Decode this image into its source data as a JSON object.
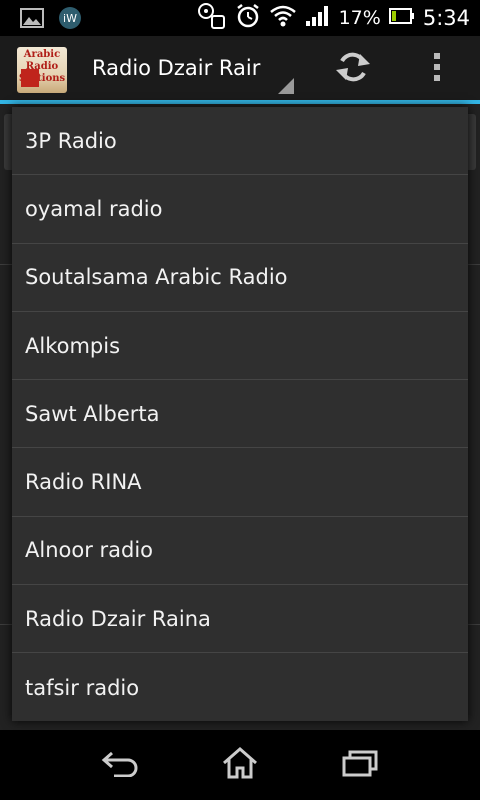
{
  "status_bar": {
    "battery_percent": "17%",
    "time": "5:34"
  },
  "action_bar": {
    "app_logo_text": "Arabic Radio Stations",
    "title": "Radio Dzair Rair"
  },
  "dropdown": {
    "items": [
      {
        "label": "3P Radio"
      },
      {
        "label": "oyamal radio"
      },
      {
        "label": "Soutalsama Arabic Radio"
      },
      {
        "label": "Alkompis"
      },
      {
        "label": "Sawt Alberta"
      },
      {
        "label": "Radio RINA"
      },
      {
        "label": "Alnoor radio"
      },
      {
        "label": "Radio Dzair Raina"
      },
      {
        "label": "tafsir radio"
      }
    ]
  },
  "colors": {
    "accent": "#33b5e5",
    "dropdown_bg": "#2f2f2f",
    "divider": "#454545"
  }
}
